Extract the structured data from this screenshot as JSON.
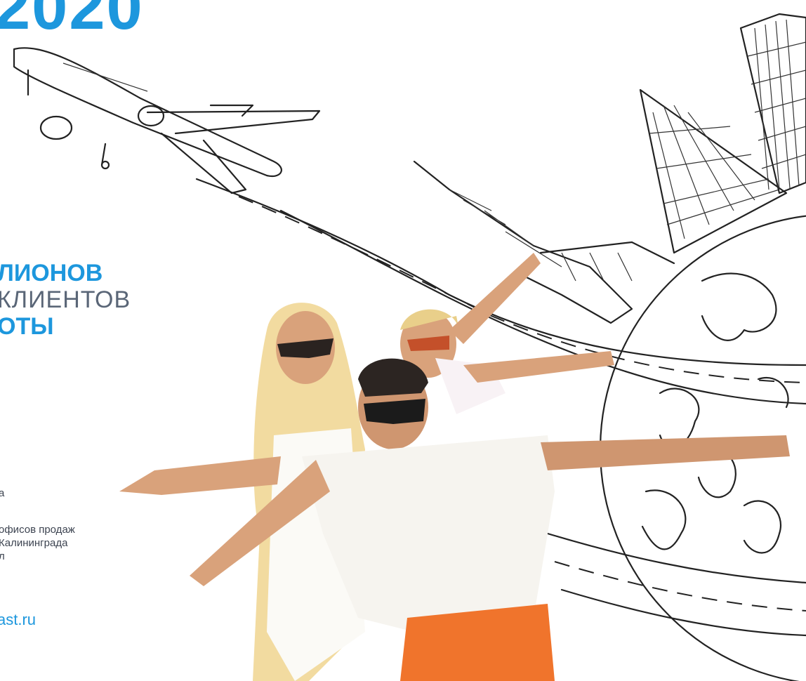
{
  "year": "2020",
  "headline": {
    "line1": "ЛИОНОВ",
    "line2": "КЛИЕНТОВ",
    "line3": "ОТЫ"
  },
  "info1": "а",
  "info2": {
    "line1": "офисов продаж",
    "line2": "Калининграда",
    "line3": "л"
  },
  "site": "ast.ru",
  "colors": {
    "accent": "#1d97dd",
    "text_gray": "#5a6677",
    "skin": "#d9a27b",
    "shirt": "#f6f4ef",
    "shorts": "#f0742c",
    "hair": "#f2dba0"
  }
}
